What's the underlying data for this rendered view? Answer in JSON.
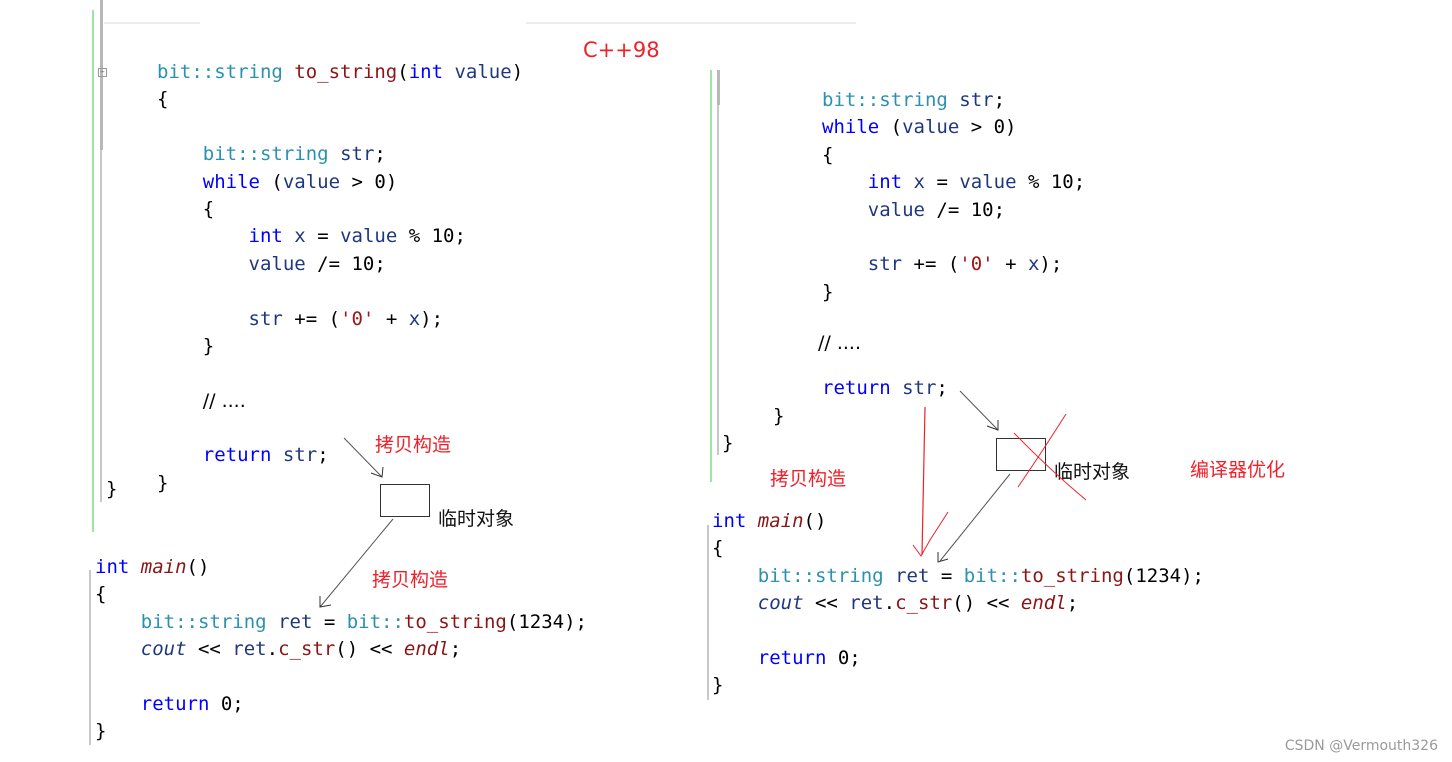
{
  "label_version": "C++98",
  "left_function": {
    "lines": [
      {
        "tokens": [
          [
            "type",
            "bit::string"
          ],
          [
            "plain",
            " "
          ],
          [
            "fn2",
            "to_string"
          ],
          [
            "plain",
            "("
          ],
          [
            "kw",
            "int"
          ],
          [
            "plain",
            " "
          ],
          [
            "var",
            "value"
          ],
          [
            "plain",
            ")"
          ]
        ]
      },
      {
        "tokens": [
          [
            "plain",
            "{"
          ]
        ]
      },
      {
        "tokens": []
      },
      {
        "tokens": [
          [
            "plain",
            "    "
          ],
          [
            "type",
            "bit::string"
          ],
          [
            "plain",
            " "
          ],
          [
            "var",
            "str"
          ],
          [
            "plain",
            ";"
          ]
        ]
      },
      {
        "tokens": [
          [
            "plain",
            "    "
          ],
          [
            "kw",
            "while"
          ],
          [
            "plain",
            " ("
          ],
          [
            "var",
            "value"
          ],
          [
            "plain",
            " > 0)"
          ]
        ]
      },
      {
        "tokens": [
          [
            "plain",
            "    {"
          ]
        ]
      },
      {
        "tokens": [
          [
            "plain",
            "        "
          ],
          [
            "kw",
            "int"
          ],
          [
            "plain",
            " "
          ],
          [
            "var",
            "x"
          ],
          [
            "plain",
            " = "
          ],
          [
            "var",
            "value"
          ],
          [
            "plain",
            " % 10;"
          ]
        ]
      },
      {
        "tokens": [
          [
            "plain",
            "        "
          ],
          [
            "var",
            "value"
          ],
          [
            "plain",
            " /= 10;"
          ]
        ]
      },
      {
        "tokens": []
      },
      {
        "tokens": [
          [
            "plain",
            "        "
          ],
          [
            "var",
            "str"
          ],
          [
            "plain",
            " += ("
          ],
          [
            "str",
            "'0'"
          ],
          [
            "plain",
            " + "
          ],
          [
            "var",
            "x"
          ],
          [
            "plain",
            ");"
          ]
        ]
      },
      {
        "tokens": [
          [
            "plain",
            "    }"
          ]
        ]
      },
      {
        "tokens": []
      },
      {
        "tokens": [
          [
            "plain",
            "    "
          ],
          [
            "cmt",
            "// ...."
          ]
        ]
      },
      {
        "tokens": []
      },
      {
        "tokens": [
          [
            "plain",
            "    "
          ],
          [
            "kw",
            "return"
          ],
          [
            "plain",
            " "
          ],
          [
            "var",
            "str"
          ],
          [
            "plain",
            ";"
          ]
        ]
      },
      {
        "tokens": [
          [
            "plain",
            "}"
          ]
        ]
      }
    ],
    "outer_close": "}"
  },
  "left_main": {
    "lines": [
      {
        "tokens": [
          [
            "kw",
            "int"
          ],
          [
            "plain",
            " "
          ],
          [
            "fn2it",
            "main"
          ],
          [
            "plain",
            "()"
          ]
        ]
      },
      {
        "tokens": [
          [
            "plain",
            "{"
          ]
        ]
      },
      {
        "tokens": [
          [
            "plain",
            "    "
          ],
          [
            "type",
            "bit::string"
          ],
          [
            "plain",
            " "
          ],
          [
            "var",
            "ret"
          ],
          [
            "plain",
            " = "
          ],
          [
            "type",
            "bit::"
          ],
          [
            "fn2",
            "to_string"
          ],
          [
            "plain",
            "(1234);"
          ]
        ]
      },
      {
        "tokens": [
          [
            "plain",
            "    "
          ],
          [
            "cout",
            "cout"
          ],
          [
            "plain",
            " << "
          ],
          [
            "var",
            "ret"
          ],
          [
            "plain",
            "."
          ],
          [
            "fn2",
            "c_str"
          ],
          [
            "plain",
            "() << "
          ],
          [
            "endl",
            "endl"
          ],
          [
            "plain",
            ";"
          ]
        ]
      },
      {
        "tokens": []
      },
      {
        "tokens": [
          [
            "plain",
            "    "
          ],
          [
            "kw",
            "return"
          ],
          [
            "plain",
            " 0;"
          ]
        ]
      },
      {
        "tokens": [
          [
            "plain",
            "}"
          ]
        ]
      }
    ]
  },
  "right_function": {
    "lines": [
      {
        "tokens": [
          [
            "type",
            "bit::string"
          ],
          [
            "plain",
            " "
          ],
          [
            "var",
            "str"
          ],
          [
            "plain",
            ";"
          ]
        ]
      },
      {
        "tokens": [
          [
            "kw",
            "while"
          ],
          [
            "plain",
            " ("
          ],
          [
            "var",
            "value"
          ],
          [
            "plain",
            " > 0)"
          ]
        ]
      },
      {
        "tokens": [
          [
            "plain",
            "{"
          ]
        ]
      },
      {
        "tokens": [
          [
            "plain",
            "    "
          ],
          [
            "kw",
            "int"
          ],
          [
            "plain",
            " "
          ],
          [
            "var",
            "x"
          ],
          [
            "plain",
            " = "
          ],
          [
            "var",
            "value"
          ],
          [
            "plain",
            " % 10;"
          ]
        ]
      },
      {
        "tokens": [
          [
            "plain",
            "    "
          ],
          [
            "var",
            "value"
          ],
          [
            "plain",
            " /= 10;"
          ]
        ]
      },
      {
        "tokens": []
      },
      {
        "tokens": [
          [
            "plain",
            "    "
          ],
          [
            "var",
            "str"
          ],
          [
            "plain",
            " += ("
          ],
          [
            "str",
            "'0'"
          ],
          [
            "plain",
            " + "
          ],
          [
            "var",
            "x"
          ],
          [
            "plain",
            ");"
          ]
        ]
      },
      {
        "tokens": [
          [
            "plain",
            "}"
          ]
        ]
      }
    ],
    "comment": "// ....",
    "return_line": [
      [
        "kw",
        "return"
      ],
      [
        "plain",
        " "
      ],
      [
        "var",
        "str"
      ],
      [
        "plain",
        ";"
      ]
    ],
    "inner_close": "}",
    "outer_close": "}"
  },
  "right_main": {
    "lines": [
      {
        "tokens": [
          [
            "kw",
            "int"
          ],
          [
            "plain",
            " "
          ],
          [
            "fn2it",
            "main"
          ],
          [
            "plain",
            "()"
          ]
        ]
      },
      {
        "tokens": [
          [
            "plain",
            "{"
          ]
        ]
      },
      {
        "tokens": [
          [
            "plain",
            "    "
          ],
          [
            "type",
            "bit::string"
          ],
          [
            "plain",
            " "
          ],
          [
            "var",
            "ret"
          ],
          [
            "plain",
            " = "
          ],
          [
            "type",
            "bit::"
          ],
          [
            "fn2",
            "to_string"
          ],
          [
            "plain",
            "(1234);"
          ]
        ]
      },
      {
        "tokens": [
          [
            "plain",
            "    "
          ],
          [
            "cout",
            "cout"
          ],
          [
            "plain",
            " << "
          ],
          [
            "var",
            "ret"
          ],
          [
            "plain",
            "."
          ],
          [
            "fn2",
            "c_str"
          ],
          [
            "plain",
            "() << "
          ],
          [
            "endl",
            "endl"
          ],
          [
            "plain",
            ";"
          ]
        ]
      },
      {
        "tokens": []
      },
      {
        "tokens": [
          [
            "plain",
            "    "
          ],
          [
            "kw",
            "return"
          ],
          [
            "plain",
            " 0;"
          ]
        ]
      },
      {
        "tokens": [
          [
            "plain",
            "}"
          ]
        ]
      }
    ]
  },
  "annotations": {
    "copy_construct": "拷贝构造",
    "temp_object": "临时对象",
    "compiler_optimization": "编译器优化"
  },
  "watermark": "CSDN @Vermouth326",
  "colors": {
    "annotation_red": "#f0202a",
    "keyword": "#0000ff",
    "type": "#2b91af",
    "variable": "#1f377f",
    "function": "#8a1515",
    "string_literal": "#a31515"
  }
}
